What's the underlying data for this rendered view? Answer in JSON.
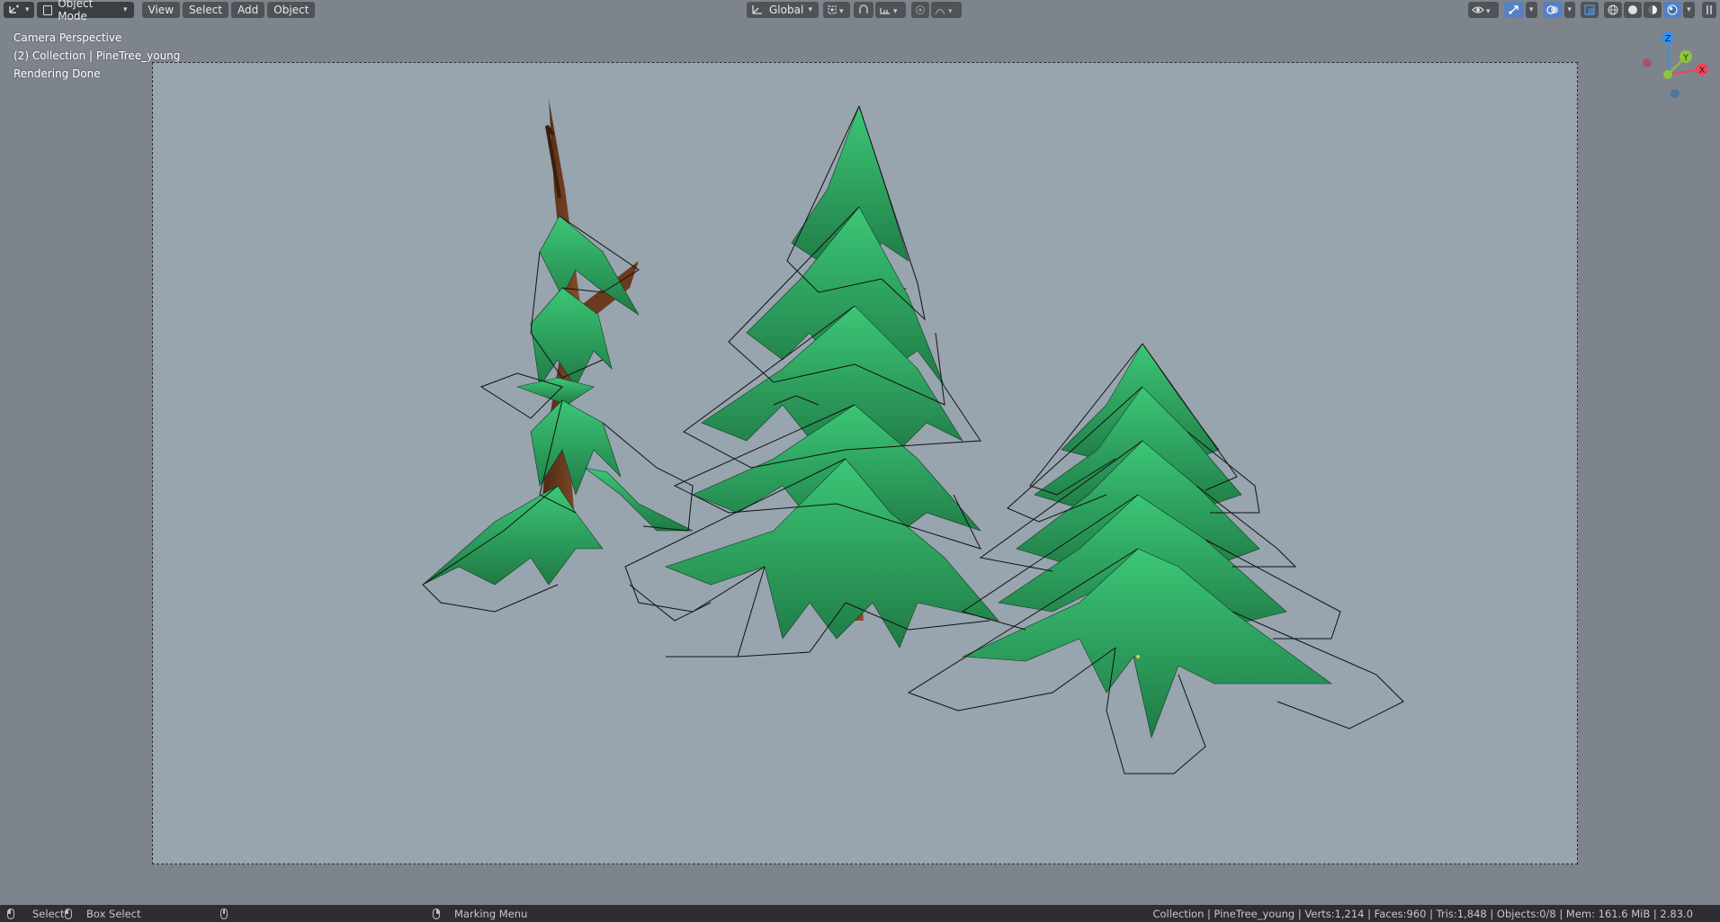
{
  "header": {
    "editor_type_icon": "viewport-editor-icon",
    "mode_label": "Object Mode",
    "menus": [
      "View",
      "Select",
      "Add",
      "Object"
    ],
    "transform_orientation": "Global",
    "icons": {
      "pivot": "pivot-point-icon",
      "snap": "snap-magnet-icon",
      "snap_target": "snap-increment-icon",
      "proportional": "proportional-editing-icon",
      "falloff": "falloff-curve-icon",
      "visibility": "visibility-eye-icon",
      "gizmo": "gizmo-toggle-icon",
      "overlays": "overlays-icon",
      "xray": "xray-icon",
      "shading_wire": "wireframe-shading-icon",
      "shading_solid": "solid-shading-icon",
      "shading_material": "material-preview-icon",
      "shading_rendered": "rendered-shading-icon",
      "sidebar": "sidebar-toggle-icon"
    }
  },
  "overlay": {
    "view_name": "Camera Perspective",
    "collection": "(2) Collection | PineTree_young",
    "render_status": "Rendering Done"
  },
  "gizmo": {
    "z": "Z",
    "y": "Y",
    "x": "X",
    "colors": {
      "x": "#e8485a",
      "y": "#8cc63a",
      "z": "#3b8fe8"
    }
  },
  "status_bar": {
    "select": "Select",
    "box_select": "Box Select",
    "marking_menu": "Marking Menu",
    "stats": "Collection | PineTree_young | Verts:1,214 | Faces:960 | Tris:1,848 | Objects:0/8 | Mem: 161.6 MiB | 2.83.0"
  },
  "colors": {
    "background": "#7e848c",
    "camera_frame": "#98a4ae",
    "accent": "#5680c2",
    "foliage": "#2f9a5c",
    "trunk": "#6b3a1f"
  }
}
